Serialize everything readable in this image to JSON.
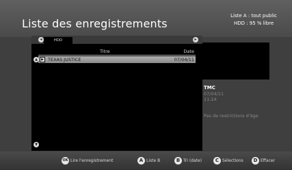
{
  "header": {
    "title": "Liste des enregistrements",
    "info_line1": "Liste A : tout public",
    "info_line2": "HDD : 95 % libre"
  },
  "tabs": {
    "active": "HDD"
  },
  "table": {
    "columns": [
      "Titre",
      "Date"
    ],
    "rows": [
      {
        "title": "TEXAS JUSTICE",
        "date": "07/04/11"
      }
    ]
  },
  "details": {
    "channel": "TMC",
    "date": "07/04/11",
    "time": "11:24",
    "restriction": "Pas de restrictions d'âge"
  },
  "footer": {
    "ok_label": "Lire l'enregistrement",
    "a_label": "Liste B",
    "b_label": "Tri (date)",
    "c_label": "Sélections",
    "d_label": "Effacer"
  }
}
